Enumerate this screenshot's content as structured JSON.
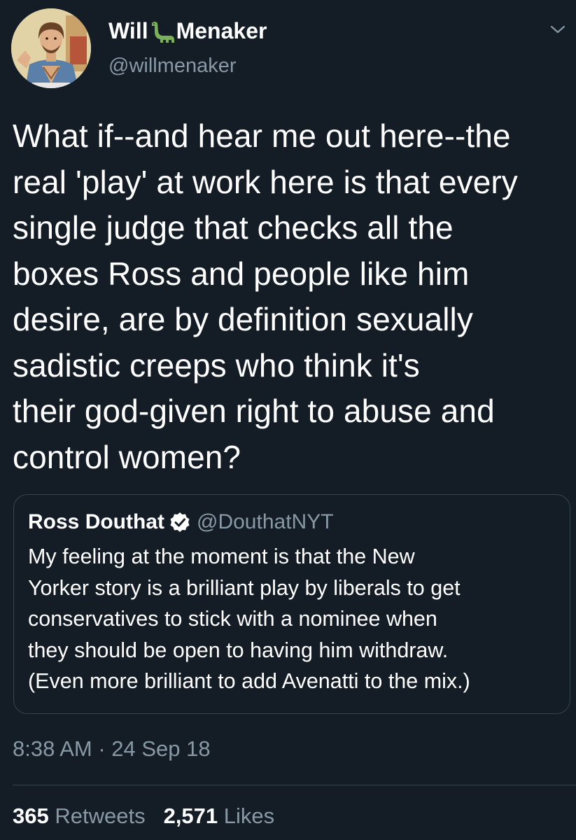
{
  "author": {
    "name_part1": "Will",
    "name_emoji": "sauropod-dinosaur-emoji",
    "name_part2": "Menaker",
    "handle": "@willmenaker",
    "avatar": "retro-illustrated-man-avatar"
  },
  "tweet": {
    "text_lines": [
      "What if--and hear me out here--the",
      "real 'play' at work here is that every",
      "single judge that checks all the",
      "boxes Ross and people like him",
      "desire, are by definition sexually",
      "sadistic creeps who think it's",
      "their god-given right to abuse and",
      "control women?"
    ]
  },
  "quoted_tweet": {
    "name": "Ross Douthat",
    "verified_icon": "verified-badge-icon",
    "handle": "@DouthatNYT",
    "text_lines": [
      "My feeling at the moment is that the New",
      "Yorker story is a brilliant play by liberals to get",
      "conservatives to stick with a nominee when",
      "they should be open to having him withdraw.",
      "(Even more brilliant to add Avenatti to the mix.)"
    ]
  },
  "timestamp": "8:38 AM · 24 Sep 18",
  "stats": {
    "retweets_count": "365",
    "retweets_label": "Retweets",
    "likes_count": "2,571",
    "likes_label": "Likes"
  },
  "icons": {
    "menu": "chevron-down-icon"
  },
  "colors": {
    "background": "#141d26",
    "primary_text": "#ffffff",
    "secondary_text": "#8899a6",
    "border": "#38444d",
    "verified_badge": "#ffffff"
  }
}
